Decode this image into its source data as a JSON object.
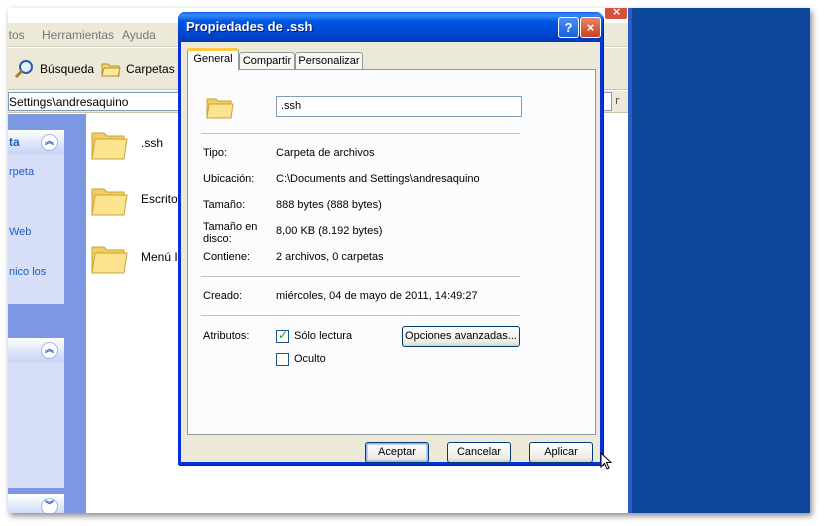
{
  "explorer": {
    "menu": [
      "itos",
      "Herramientas",
      "Ayuda"
    ],
    "toolbar": {
      "search_label": "Búsqueda",
      "folders_label": "Carpetas"
    },
    "address_text": "Settings\\andresaquino",
    "address_right": "r",
    "sidebar": {
      "panel1_title": "ta",
      "panel1_links": [
        "rpeta",
        "Web",
        "nico los"
      ]
    },
    "files": [
      {
        "name": ".ssh"
      },
      {
        "name": "Escritorio"
      },
      {
        "name": "Menú Inicio"
      }
    ]
  },
  "dialog": {
    "title": "Propiedades de .ssh",
    "help_glyph": "?",
    "close_glyph": "×",
    "tabs": [
      "General",
      "Compartir",
      "Personalizar"
    ],
    "name_value": ".ssh",
    "fields": {
      "tipo_label": "Tipo:",
      "tipo_value": "Carpeta de archivos",
      "ubicacion_label": "Ubicación:",
      "ubicacion_value": "C:\\Documents and Settings\\andresaquino",
      "tamano_label": "Tamaño:",
      "tamano_value": "888 bytes (888 bytes)",
      "tamano_disco_label_1": "Tamaño en",
      "tamano_disco_label_2": "disco:",
      "tamano_disco_value": "8,00 KB (8.192 bytes)",
      "contiene_label": "Contiene:",
      "contiene_value": "2 archivos, 0 carpetas",
      "creado_label": "Creado:",
      "creado_value": "miércoles, 04 de mayo de 2011, 14:49:27",
      "atributos_label": "Atributos:"
    },
    "attributes": {
      "readonly_label": "Sólo lectura",
      "readonly_checked": true,
      "hidden_label": "Oculto",
      "hidden_checked": false,
      "advanced_label": "Opciones avanzadas..."
    },
    "buttons": {
      "ok": "Aceptar",
      "cancel": "Cancelar",
      "apply": "Aplicar"
    }
  },
  "colors": {
    "desktop": "#0d479c",
    "titlebar": "#0058e6",
    "link": "#215dc6"
  }
}
